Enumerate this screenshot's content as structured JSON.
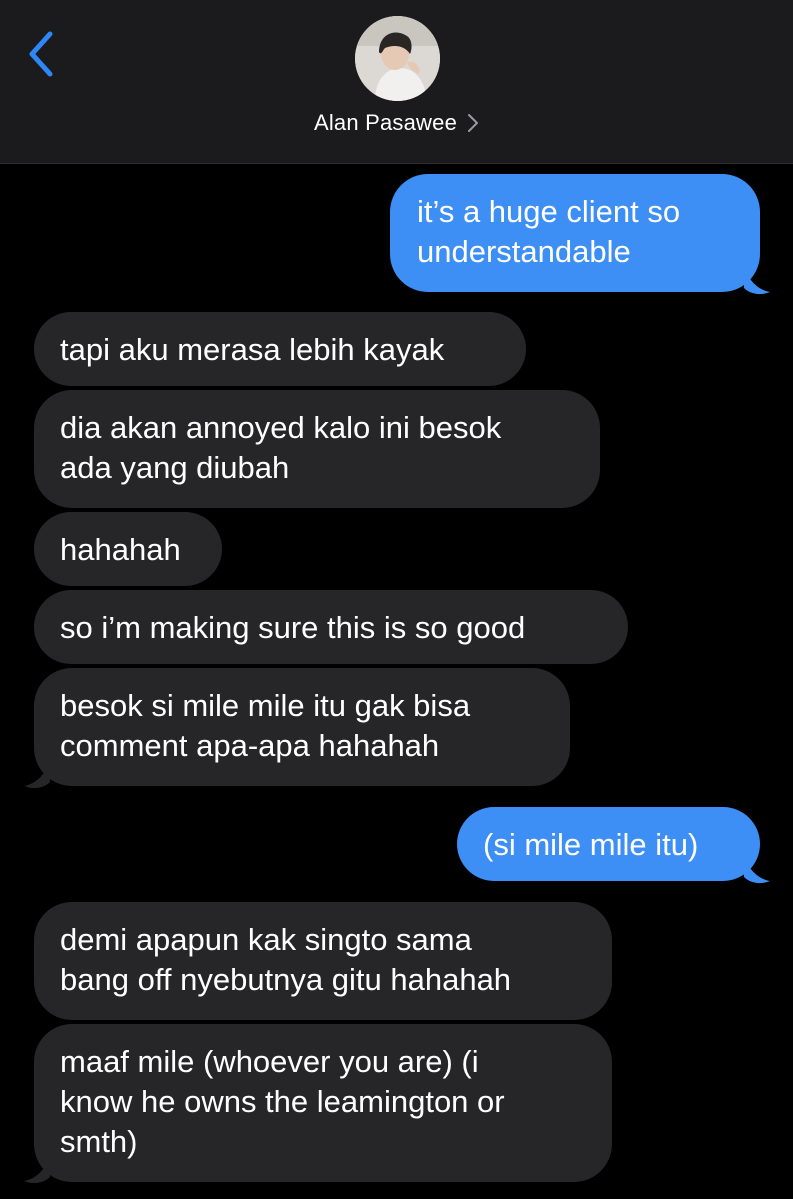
{
  "header": {
    "contact_name": "Alan Pasawee",
    "back_icon": "chevron-left-icon",
    "contact_chevron_icon": "chevron-right-icon"
  },
  "colors": {
    "background": "#000000",
    "header_bg": "#1b1b1d",
    "incoming_bubble": "#262628",
    "outgoing_bubble": "#3d8ff5",
    "accent": "#2f86f6"
  },
  "messages": [
    {
      "sender": "me",
      "text": "it’s a huge client so\nunderstandable"
    },
    {
      "sender": "them",
      "text": "tapi aku merasa lebih kayak"
    },
    {
      "sender": "them",
      "text": "dia akan annoyed kalo ini besok\nada yang diubah"
    },
    {
      "sender": "them",
      "text": "hahahah"
    },
    {
      "sender": "them",
      "text": "so i’m making sure this is so good"
    },
    {
      "sender": "them",
      "text": "besok si mile mile itu gak bisa\ncomment apa-apa hahahah"
    },
    {
      "sender": "me",
      "text": "(si mile mile itu)"
    },
    {
      "sender": "them",
      "text": "demi apapun kak singto sama\nbang off nyebutnya gitu hahahah"
    },
    {
      "sender": "them",
      "text": "maaf mile (whoever you are) (i\nknow he owns the leamington or\nsmth)"
    }
  ]
}
